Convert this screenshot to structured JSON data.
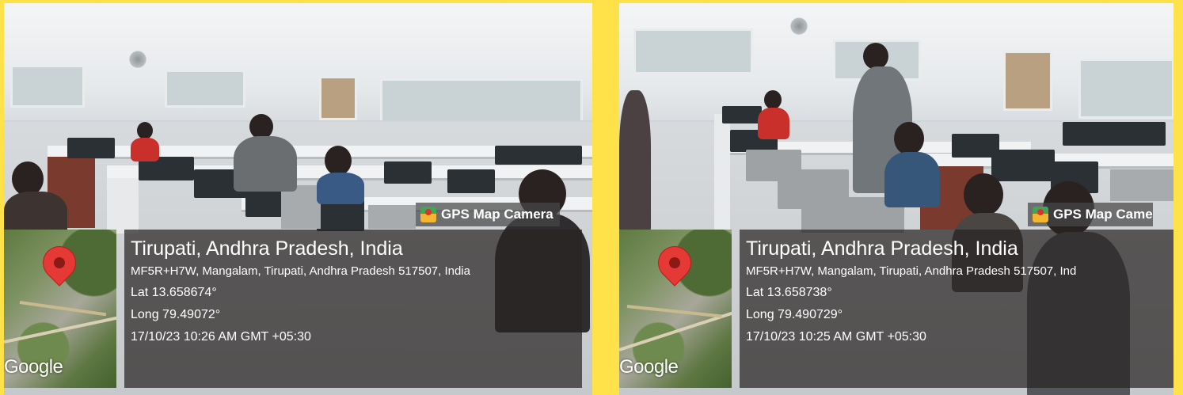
{
  "colors": {
    "frame_background": "#ffe14a",
    "panel_background": "#3a3432",
    "map_pin": "#e53935",
    "text": "#ffffff"
  },
  "photos": [
    {
      "overlay_label": "GPS Map Camera",
      "map_logo": "Google",
      "title": "Tirupati, Andhra Pradesh, India",
      "address": "MF5R+H7W, Mangalam, Tirupati, Andhra Pradesh 517507, India",
      "lat": "Lat 13.658674°",
      "long": "Long 79.49072°",
      "timestamp": "17/10/23 10:26 AM GMT +05:30"
    },
    {
      "overlay_label": "GPS Map Came",
      "map_logo": "Google",
      "title": "Tirupati, Andhra Pradesh, India",
      "address": "MF5R+H7W, Mangalam, Tirupati, Andhra Pradesh 517507, Ind",
      "lat": "Lat 13.658738°",
      "long": "Long 79.490729°",
      "timestamp": "17/10/23 10:25 AM GMT +05:30"
    }
  ]
}
